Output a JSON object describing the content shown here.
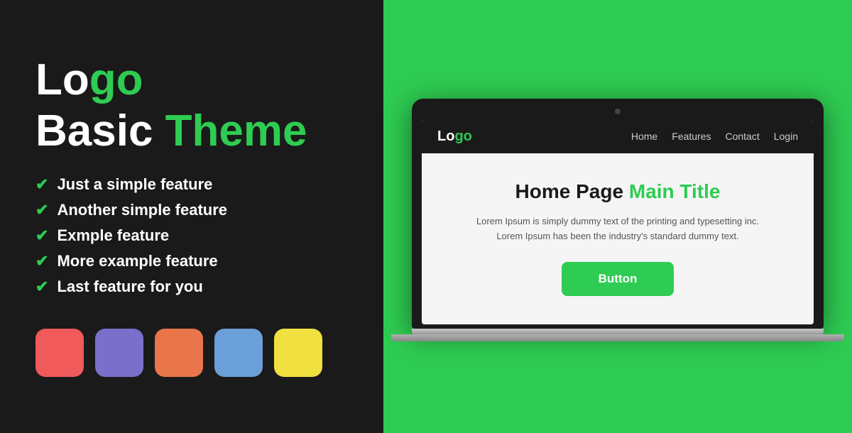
{
  "left": {
    "logo": {
      "part1": "Lo",
      "part2": "go"
    },
    "subtitle": {
      "part1": "Basic ",
      "part2": "Theme"
    },
    "features": [
      "Just a simple feature",
      "Another simple feature",
      "Exmple feature",
      "More example feature",
      "Last feature for you"
    ],
    "swatches": [
      {
        "name": "red",
        "class": "swatch-red"
      },
      {
        "name": "purple",
        "class": "swatch-purple"
      },
      {
        "name": "orange",
        "class": "swatch-orange"
      },
      {
        "name": "blue",
        "class": "swatch-blue"
      },
      {
        "name": "yellow",
        "class": "swatch-yellow"
      }
    ]
  },
  "laptop": {
    "navbar": {
      "logo_part1": "Lo",
      "logo_part2": "go",
      "links": [
        "Home",
        "Features",
        "Contact",
        "Login"
      ]
    },
    "hero": {
      "title_part1": "Home Page ",
      "title_part2": "Main Title",
      "body": "Lorem Ipsum is simply dummy text of the printing and typesetting inc. Lorem Ipsum has been the industry's standard dummy text.",
      "button_label": "Button"
    }
  },
  "check_symbol": "✔"
}
